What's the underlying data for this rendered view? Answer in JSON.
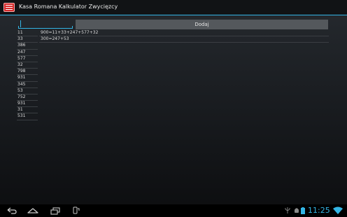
{
  "app": {
    "title": "Kasa Romana Kalkulator Zwycięzcy",
    "icon": "app-logo-icon"
  },
  "input": {
    "value": "",
    "placeholder": ""
  },
  "add_button": {
    "label": "Dodaj"
  },
  "numbers": [
    "11",
    "33",
    "386",
    "247",
    "577",
    "32",
    "798",
    "931",
    "345",
    "53",
    "752",
    "931",
    "31",
    "531"
  ],
  "results": [
    "900=11+33+247+577+32",
    "300=247+53"
  ],
  "statusbar": {
    "clock": "11:25"
  },
  "colors": {
    "accent": "#33b5e5",
    "icon_red": "#d52a2a",
    "button_bg": "#54585c"
  },
  "nav": {
    "icons": [
      "back-icon",
      "home-icon",
      "recent-apps-icon",
      "screenshot-icon"
    ]
  }
}
